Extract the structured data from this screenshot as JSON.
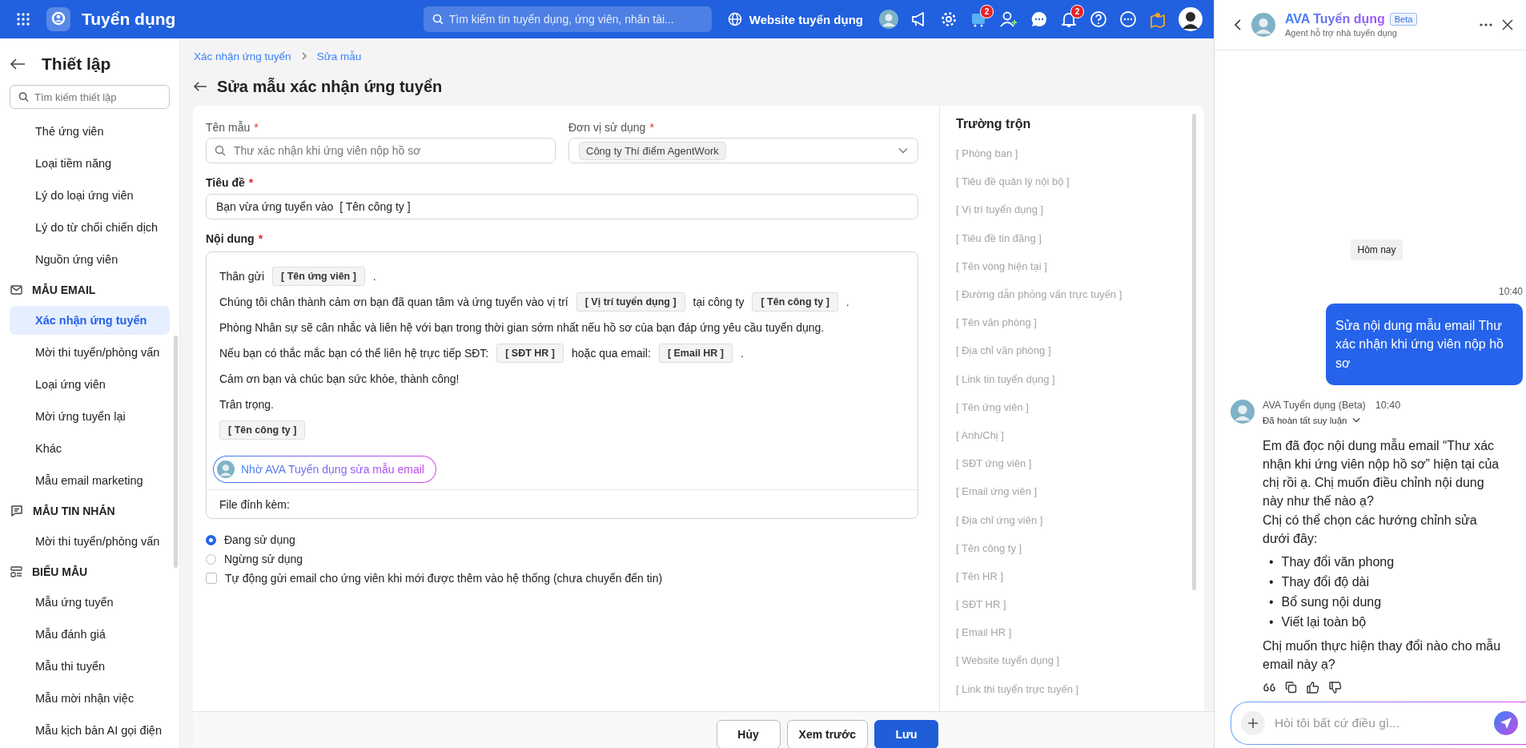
{
  "topbar": {
    "app_title": "Tuyển dụng",
    "search_placeholder": "Tìm kiếm tin tuyển dụng, ứng viên, nhân tài...",
    "website_link": "Website tuyển dụng",
    "icons": [
      {
        "kind": "avatar"
      },
      {
        "kind": "megaphone"
      },
      {
        "kind": "gear"
      },
      {
        "kind": "cart",
        "badge": "2"
      },
      {
        "kind": "user-add"
      },
      {
        "kind": "chat"
      },
      {
        "kind": "bell",
        "badge": "2"
      },
      {
        "kind": "help"
      },
      {
        "kind": "more"
      },
      {
        "kind": "map"
      },
      {
        "kind": "user"
      }
    ]
  },
  "sidebar": {
    "title": "Thiết lập",
    "search_placeholder": "Tìm kiếm thiết lập",
    "sections": [
      {
        "items": [
          {
            "label": "Thẻ ứng viên",
            "selected": false
          },
          {
            "label": "Loại tiềm năng",
            "selected": false
          },
          {
            "label": "Lý do loại ứng viên",
            "selected": false
          },
          {
            "label": "Lý do từ chối chiến dịch",
            "selected": false
          },
          {
            "label": "Nguồn ứng viên",
            "selected": false
          }
        ]
      },
      {
        "title": "MẪU EMAIL",
        "kind": "email",
        "items": [
          {
            "label": "Xác nhận ứng tuyển",
            "selected": true
          },
          {
            "label": "Mời thi tuyển/phỏng vấn",
            "selected": false
          },
          {
            "label": "Loại ứng viên",
            "selected": false
          },
          {
            "label": "Mời ứng tuyển lại",
            "selected": false
          },
          {
            "label": "Khác",
            "selected": false
          },
          {
            "label": "Mẫu email marketing",
            "selected": false
          }
        ]
      },
      {
        "title": "MẪU TIN NHẮN",
        "kind": "message",
        "items": [
          {
            "label": "Mời thi tuyển/phỏng vấn",
            "selected": false
          }
        ]
      },
      {
        "title": "BIỂU MẪU",
        "kind": "form",
        "items": [
          {
            "label": "Mẫu ứng tuyển",
            "selected": false
          },
          {
            "label": "Mẫu đánh giá",
            "selected": false
          },
          {
            "label": "Mẫu thi tuyển",
            "selected": false
          },
          {
            "label": "Mẫu mời nhận việc",
            "selected": false
          },
          {
            "label": "Mẫu kịch bản AI gọi điện",
            "selected": false
          }
        ]
      }
    ]
  },
  "breadcrumb": [
    "Xác nhận ứng tuyển",
    "Sửa mẫu"
  ],
  "page_title": "Sửa mẫu xác nhận ứng tuyển",
  "form": {
    "required_mark": "*",
    "template_name": {
      "label": "Tên mẫu",
      "placeholder": "Thư xác nhận khi ứng viên nộp hồ sơ"
    },
    "unit": {
      "label": "Đơn vị sử dụng",
      "tag": "Công ty Thí điểm AgentWork"
    },
    "subject": {
      "label": "Tiêu đề",
      "value": "Bạn vừa ứng tuyển vào  [ Tên công ty ]"
    },
    "content": {
      "label": "Nội dung",
      "lines": [
        [
          {
            "kind": "text",
            "text": "Thân gửi"
          },
          {
            "kind": "field",
            "text": "[ Tên ứng viên ]"
          },
          {
            "kind": "text",
            "text": "."
          }
        ],
        [
          {
            "kind": "text",
            "text": "Chúng tôi chân thành cảm ơn bạn đã quan tâm và ứng tuyển vào vị trí"
          },
          {
            "kind": "field",
            "text": "[ Vị trí tuyển dụng ]"
          },
          {
            "kind": "text",
            "text": "tại công ty"
          },
          {
            "kind": "field",
            "text": "[ Tên công ty ]"
          },
          {
            "kind": "text",
            "text": "."
          }
        ],
        [
          {
            "kind": "text",
            "text": "Phòng Nhân sự sẽ cân nhắc và liên hệ với bạn trong thời gian sớm nhất nếu hồ sơ của bạn đáp ứng yêu cầu tuyển dụng."
          }
        ],
        [
          {
            "kind": "text",
            "text": "Nếu bạn có thắc mắc bạn có thể liên hệ trực tiếp SĐT:"
          },
          {
            "kind": "field",
            "text": "[ SĐT HR ]"
          },
          {
            "kind": "text",
            "text": "hoặc qua email:"
          },
          {
            "kind": "field",
            "text": "[ Email HR ]"
          },
          {
            "kind": "text",
            "text": "."
          }
        ],
        [
          {
            "kind": "text",
            "text": "Cảm ơn bạn và chúc bạn sức khỏe, thành công!"
          }
        ],
        [
          {
            "kind": "text",
            "text": "Trân trọng."
          }
        ],
        [
          {
            "kind": "field",
            "text": "[ Tên công ty ]"
          }
        ]
      ],
      "ai_button": "Nhờ AVA Tuyển dụng sửa mẫu email",
      "attachment_label": "File đính kèm:"
    },
    "status": [
      {
        "label": "Đang sử dụng",
        "selected": true
      },
      {
        "label": "Ngừng sử dụng",
        "selected": false
      }
    ],
    "auto_send": {
      "label": "Tự động gửi email cho ứng viên khi mới được thêm vào hệ thống (chưa chuyển đến tin)",
      "checked": false
    }
  },
  "merge_fields": {
    "title": "Trường trộn",
    "items": [
      "[ Phòng ban ]",
      "[ Tiêu đề quản lý nội bộ ]",
      "[ Vị trí tuyển dụng ]",
      "[ Tiêu đề tin đăng ]",
      "[ Tên vòng hiện tại ]",
      "[ Đường dẫn phỏng vấn trực tuyến ]",
      "[ Tên văn phòng ]",
      "[ Địa chỉ văn phòng ]",
      "[ Link tin tuyển dụng ]",
      "[ Tên ứng viên ]",
      "[ Anh/Chị ]",
      "[ SĐT ứng viên ]",
      "[ Email ứng viên ]",
      "[ Địa chỉ ứng viên ]",
      "[ Tên công ty ]",
      "[ Tên HR ]",
      "[ SĐT HR ]",
      "[ Email HR ]",
      "[ Website tuyển dụng ]",
      "[ Link thi tuyển trực tuyến ]"
    ]
  },
  "footer_buttons": [
    {
      "label": "Hủy",
      "kind": "default"
    },
    {
      "label": "Xem trước",
      "kind": "default"
    },
    {
      "label": "Lưu",
      "kind": "primary"
    }
  ],
  "chat": {
    "title": "AVA Tuyển dụng",
    "badge": "Beta",
    "subtitle": "Agent hỗ trợ nhà tuyển dụng",
    "date_separator": "Hôm nay",
    "messages": [
      {
        "kind": "user",
        "time": "10:40",
        "text": "Sửa nội dung mẫu email Thư xác nhận khi ứng viên nộp hồ sơ"
      },
      {
        "kind": "bot",
        "sender": "AVA Tuyển dụng (Beta)",
        "time": "10:40",
        "status": "Đã hoàn tất suy luận",
        "paragraphs": [
          "Em đã đọc nội dung mẫu email “Thư xác nhận khi ứng viên nộp hồ sơ” hiện tại của chị rồi ạ. Chị muốn điều chỉnh nội dung này như thế nào ạ?",
          "Chị có thể chọn các hướng chỉnh sửa dưới đây:"
        ],
        "bullet_marker": "•",
        "bullets": [
          "Thay đổi văn phong",
          "Thay đổi độ dài",
          "Bổ sung nội dung",
          "Viết lại toàn bộ"
        ],
        "closing": "Chị muốn thực hiện thay đổi nào cho mẫu email này ạ?"
      }
    ],
    "input_placeholder": "Hỏi tôi bất cứ điều gì..."
  }
}
